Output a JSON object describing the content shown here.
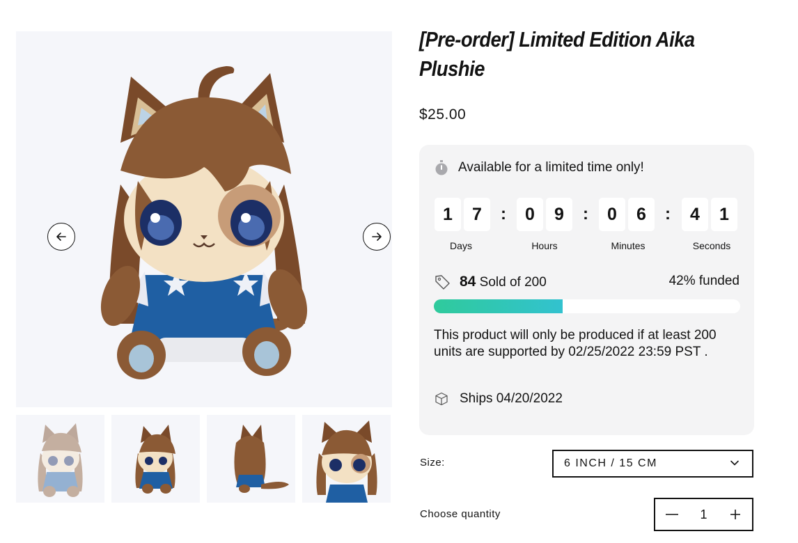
{
  "product": {
    "title": "[Pre-order] Limited Edition Aika Plushie",
    "price": "$25.00"
  },
  "gallery": {
    "prev_icon": "arrow-left-icon",
    "next_icon": "arrow-right-icon",
    "thumbnails": [
      {
        "view": "front",
        "active": false
      },
      {
        "view": "three-quarter",
        "active": true
      },
      {
        "view": "back",
        "active": true
      },
      {
        "view": "close-up",
        "active": true
      }
    ]
  },
  "campaign": {
    "limited_text": "Available for a limited time only!",
    "limited_icon": "stopwatch-icon",
    "countdown": {
      "days": [
        "1",
        "7"
      ],
      "hours": [
        "0",
        "9"
      ],
      "minutes": [
        "0",
        "6"
      ],
      "seconds": [
        "4",
        "1"
      ],
      "separator": ":",
      "labels": {
        "days": "Days",
        "hours": "Hours",
        "minutes": "Minutes",
        "seconds": "Seconds"
      }
    },
    "sold_icon": "tag-icon",
    "sold_count": "84",
    "sold_of": "Sold of 200",
    "funded": "42% funded",
    "progress_fraction": 0.42,
    "description": "This product will only be produced if at least 200 units are supported by 02/25/2022 23:59 PST .",
    "ships_icon": "box-icon",
    "ships": "Ships 04/20/2022"
  },
  "options": {
    "size_label": "Size:",
    "size_value": "6 INCH / 15 CM",
    "quantity_label": "Choose quantity",
    "quantity_value": "1"
  },
  "colors": {
    "progress_start": "#2fca9c",
    "progress_end": "#32c2cf",
    "card_bg": "#f4f4f5"
  }
}
